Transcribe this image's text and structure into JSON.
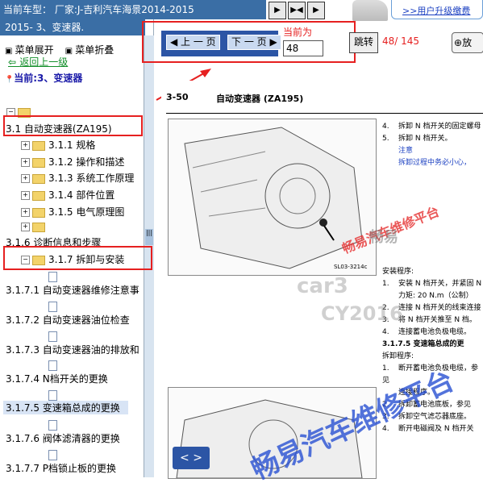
{
  "header": {
    "title": "当前车型：  厂家:J-吉利汽车海景2014-2015",
    "upgrade_link": ">>用户升级缴费"
  },
  "sidebar": {
    "heading": "2015- 3、变速器.",
    "expand_menu": "菜单展开",
    "collapse_menu": "菜单折叠",
    "back_link": "返回上一级",
    "current": "当前:3、变速器",
    "tree": [
      {
        "label": "3.1 自动变速器(ZA195)"
      },
      {
        "label": "3.1.1 规格"
      },
      {
        "label": "3.1.2 操作和描述"
      },
      {
        "label": "3.1.3 系统工作原理"
      },
      {
        "label": "3.1.4 部件位置"
      },
      {
        "label": "3.1.5 电气原理图"
      },
      {
        "label": "3.1.6 诊断信息和步骤"
      },
      {
        "label": "3.1.7 拆卸与安装"
      },
      {
        "label": "3.1.7.1 自动变速器维修注意事"
      },
      {
        "label": "3.1.7.2 自动变速器油位检查"
      },
      {
        "label": "3.1.7.3 自动变速器油的排放和"
      },
      {
        "label": "3.1.7.4 N档开关的更换"
      },
      {
        "label": "3.1.7.5 变速箱总成的更换"
      },
      {
        "label": "3.1.7.6 阀体滤清器的更换"
      },
      {
        "label": "3.1.7.7 P档锁止板的更换"
      }
    ]
  },
  "pager": {
    "prev": "上 一 页",
    "next": "下 一 页",
    "current_label": "当前为",
    "page_value": "48",
    "jump": "跳转",
    "page_count": "48/ 145",
    "zoom": "放"
  },
  "document": {
    "page_number": "3-50",
    "chapter": "自动变速器 (ZA195)",
    "figure_code": "SL03-3214c",
    "steps": [
      {
        "n": "4.",
        "text": "拆卸 N 档开关的固定螺母"
      },
      {
        "n": "5.",
        "text": "拆卸 N 档开关。"
      },
      {
        "n": "",
        "text": "注意",
        "note": true
      },
      {
        "n": "",
        "text": "拆卸过程中务必小心，",
        "note": true
      },
      {
        "n": "",
        "text": "安装程序:"
      },
      {
        "n": "1.",
        "text": "安装 N 档开关，并紧固 N"
      },
      {
        "n": "",
        "text": "力矩: 20 N.m（公制）"
      },
      {
        "n": "2.",
        "text": "连接 N 档开关的线束连接"
      },
      {
        "n": "3.",
        "text": "将 N 档开关推至 N 档。"
      },
      {
        "n": "4.",
        "text": "连接蓄电池负极电缆。"
      },
      {
        "n": "",
        "text": "3.1.7.5 变速箱总成的更"
      },
      {
        "n": "",
        "text": "拆卸程序:"
      },
      {
        "n": "1.",
        "text": "断开蓄电池负极电缆，参见"
      },
      {
        "n": "",
        "text": "连接程序。"
      },
      {
        "n": "2.",
        "text": "拆卸蓄电池底板，参见"
      },
      {
        "n": "3.",
        "text": "拆卸空气滤芯器底座。"
      },
      {
        "n": "4.",
        "text": "断开电磁阀及 N 档开关"
      }
    ]
  },
  "watermarks": {
    "site_cn": "畅易汽车维修平台",
    "brand": "畅易",
    "car_code": "car3",
    "cy_code": "CY2016"
  },
  "nav_lr": "< >"
}
